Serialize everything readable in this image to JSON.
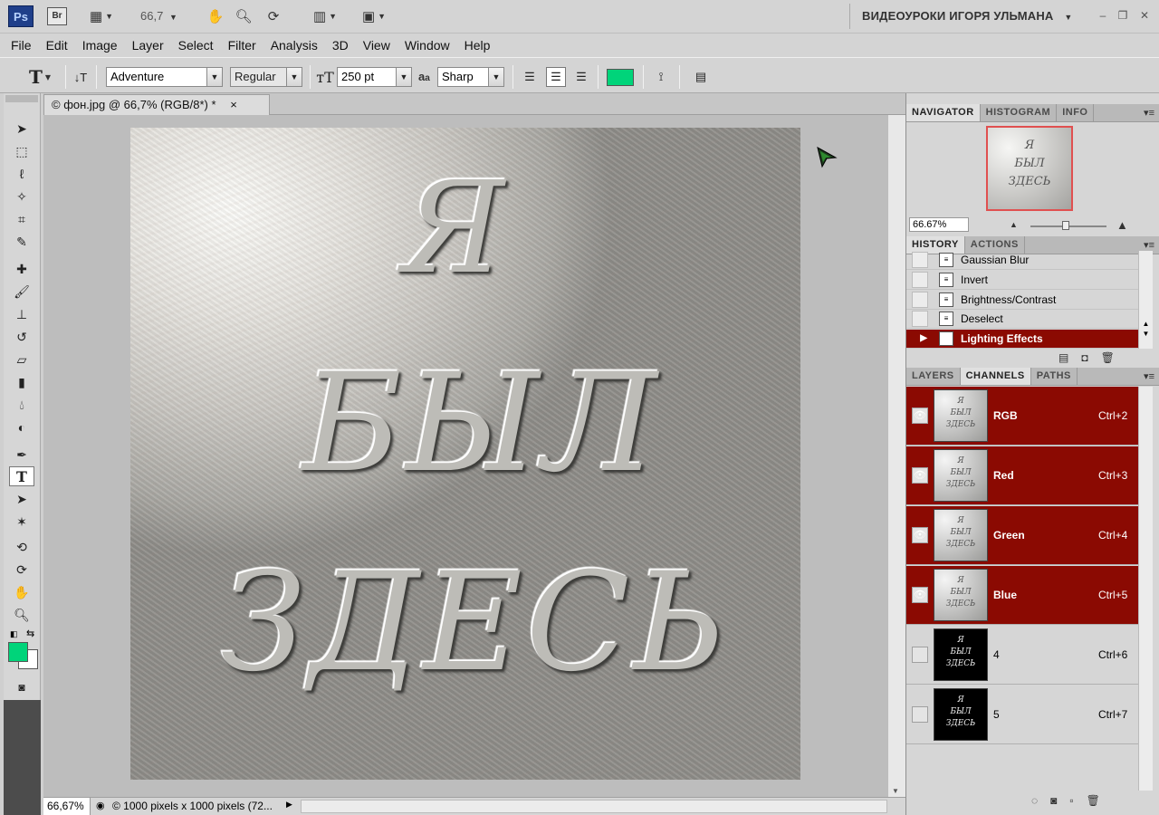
{
  "appbar": {
    "ps_logo": "Ps",
    "br_logo": "Br",
    "zoom": "66,7",
    "workspace": "ВИДЕОУРОКИ ИГОРЯ УЛЬМАНА"
  },
  "menu": [
    "File",
    "Edit",
    "Image",
    "Layer",
    "Select",
    "Filter",
    "Analysis",
    "3D",
    "View",
    "Window",
    "Help"
  ],
  "options": {
    "font_family": "Adventure",
    "font_style": "Regular",
    "font_size": "250 pt",
    "aa_label": "a",
    "aa_label_small": "a",
    "antialias": "Sharp",
    "text_color": "#00d47a"
  },
  "document": {
    "tab_title": "© фон.jpg @ 66,7% (RGB/8*) *",
    "close": "×",
    "image_text": [
      "Я",
      "БЫЛ",
      "ЗДЕСЬ"
    ]
  },
  "status": {
    "zoom": "66,67%",
    "info": "© 1000 pixels x 1000 pixels (72..."
  },
  "navigator": {
    "tabs": [
      "NAVIGATOR",
      "HISTOGRAM",
      "INFO"
    ],
    "zoom": "66.67%",
    "thumb_text": [
      "Я",
      "БЫЛ",
      "ЗДЕСЬ"
    ]
  },
  "history": {
    "tabs": [
      "HISTORY",
      "ACTIONS"
    ],
    "items": [
      "Gaussian Blur",
      "Invert",
      "Brightness/Contrast",
      "Deselect",
      "Lighting Effects"
    ]
  },
  "channels_panel": {
    "tabs": [
      "LAYERS",
      "CHANNELS",
      "PATHS"
    ],
    "channels": [
      {
        "name": "RGB",
        "shortcut": "Ctrl+2"
      },
      {
        "name": "Red",
        "shortcut": "Ctrl+3"
      },
      {
        "name": "Green",
        "shortcut": "Ctrl+4"
      },
      {
        "name": "Blue",
        "shortcut": "Ctrl+5"
      },
      {
        "name": "4",
        "shortcut": "Ctrl+6"
      },
      {
        "name": "5",
        "shortcut": "Ctrl+7"
      }
    ]
  },
  "colors": {
    "foreground": "#00d47a",
    "background": "#ffffff",
    "selection": "#8b0a02"
  }
}
